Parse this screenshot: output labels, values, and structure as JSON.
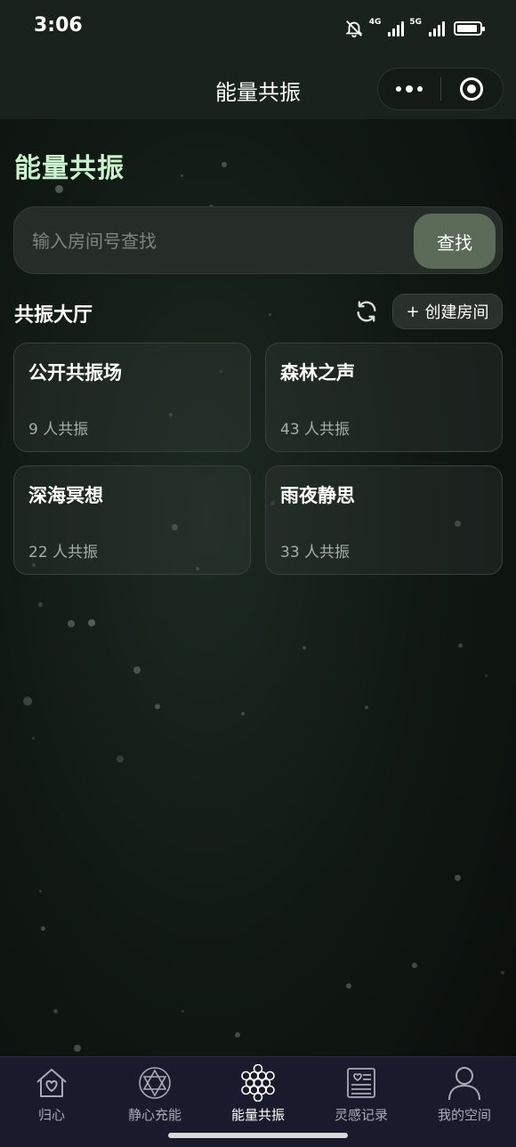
{
  "status_bar": {
    "time": "3:06",
    "network_1": "4G",
    "network_2": "5G",
    "icons": [
      "bell-muted-icon",
      "signal-icon",
      "battery-icon"
    ]
  },
  "nav": {
    "title": "能量共振",
    "more_icon": "more-dots-icon",
    "close_icon": "close-ring-icon"
  },
  "page": {
    "heading": "能量共振",
    "heading_color": "#c9f2cd"
  },
  "search": {
    "placeholder": "输入房间号查找",
    "value": "",
    "button_label": "查找"
  },
  "hall": {
    "title": "共振大厅",
    "refresh_icon": "refresh-icon",
    "create_label": "创建房间",
    "create_prefix": "+"
  },
  "rooms": [
    {
      "name": "公开共振场",
      "count": "9 人共振"
    },
    {
      "name": "森林之声",
      "count": "43 人共振"
    },
    {
      "name": "深海冥想",
      "count": "22 人共振"
    },
    {
      "name": "雨夜静思",
      "count": "33 人共振"
    }
  ],
  "tabs": [
    {
      "label": "归心",
      "icon": "home-heart-icon",
      "active": false
    },
    {
      "label": "静心充能",
      "icon": "hexagram-icon",
      "active": false
    },
    {
      "label": "能量共振",
      "icon": "honeycomb-icon",
      "active": true
    },
    {
      "label": "灵感记录",
      "icon": "journal-icon",
      "active": false
    },
    {
      "label": "我的空间",
      "icon": "user-icon",
      "active": false
    }
  ]
}
